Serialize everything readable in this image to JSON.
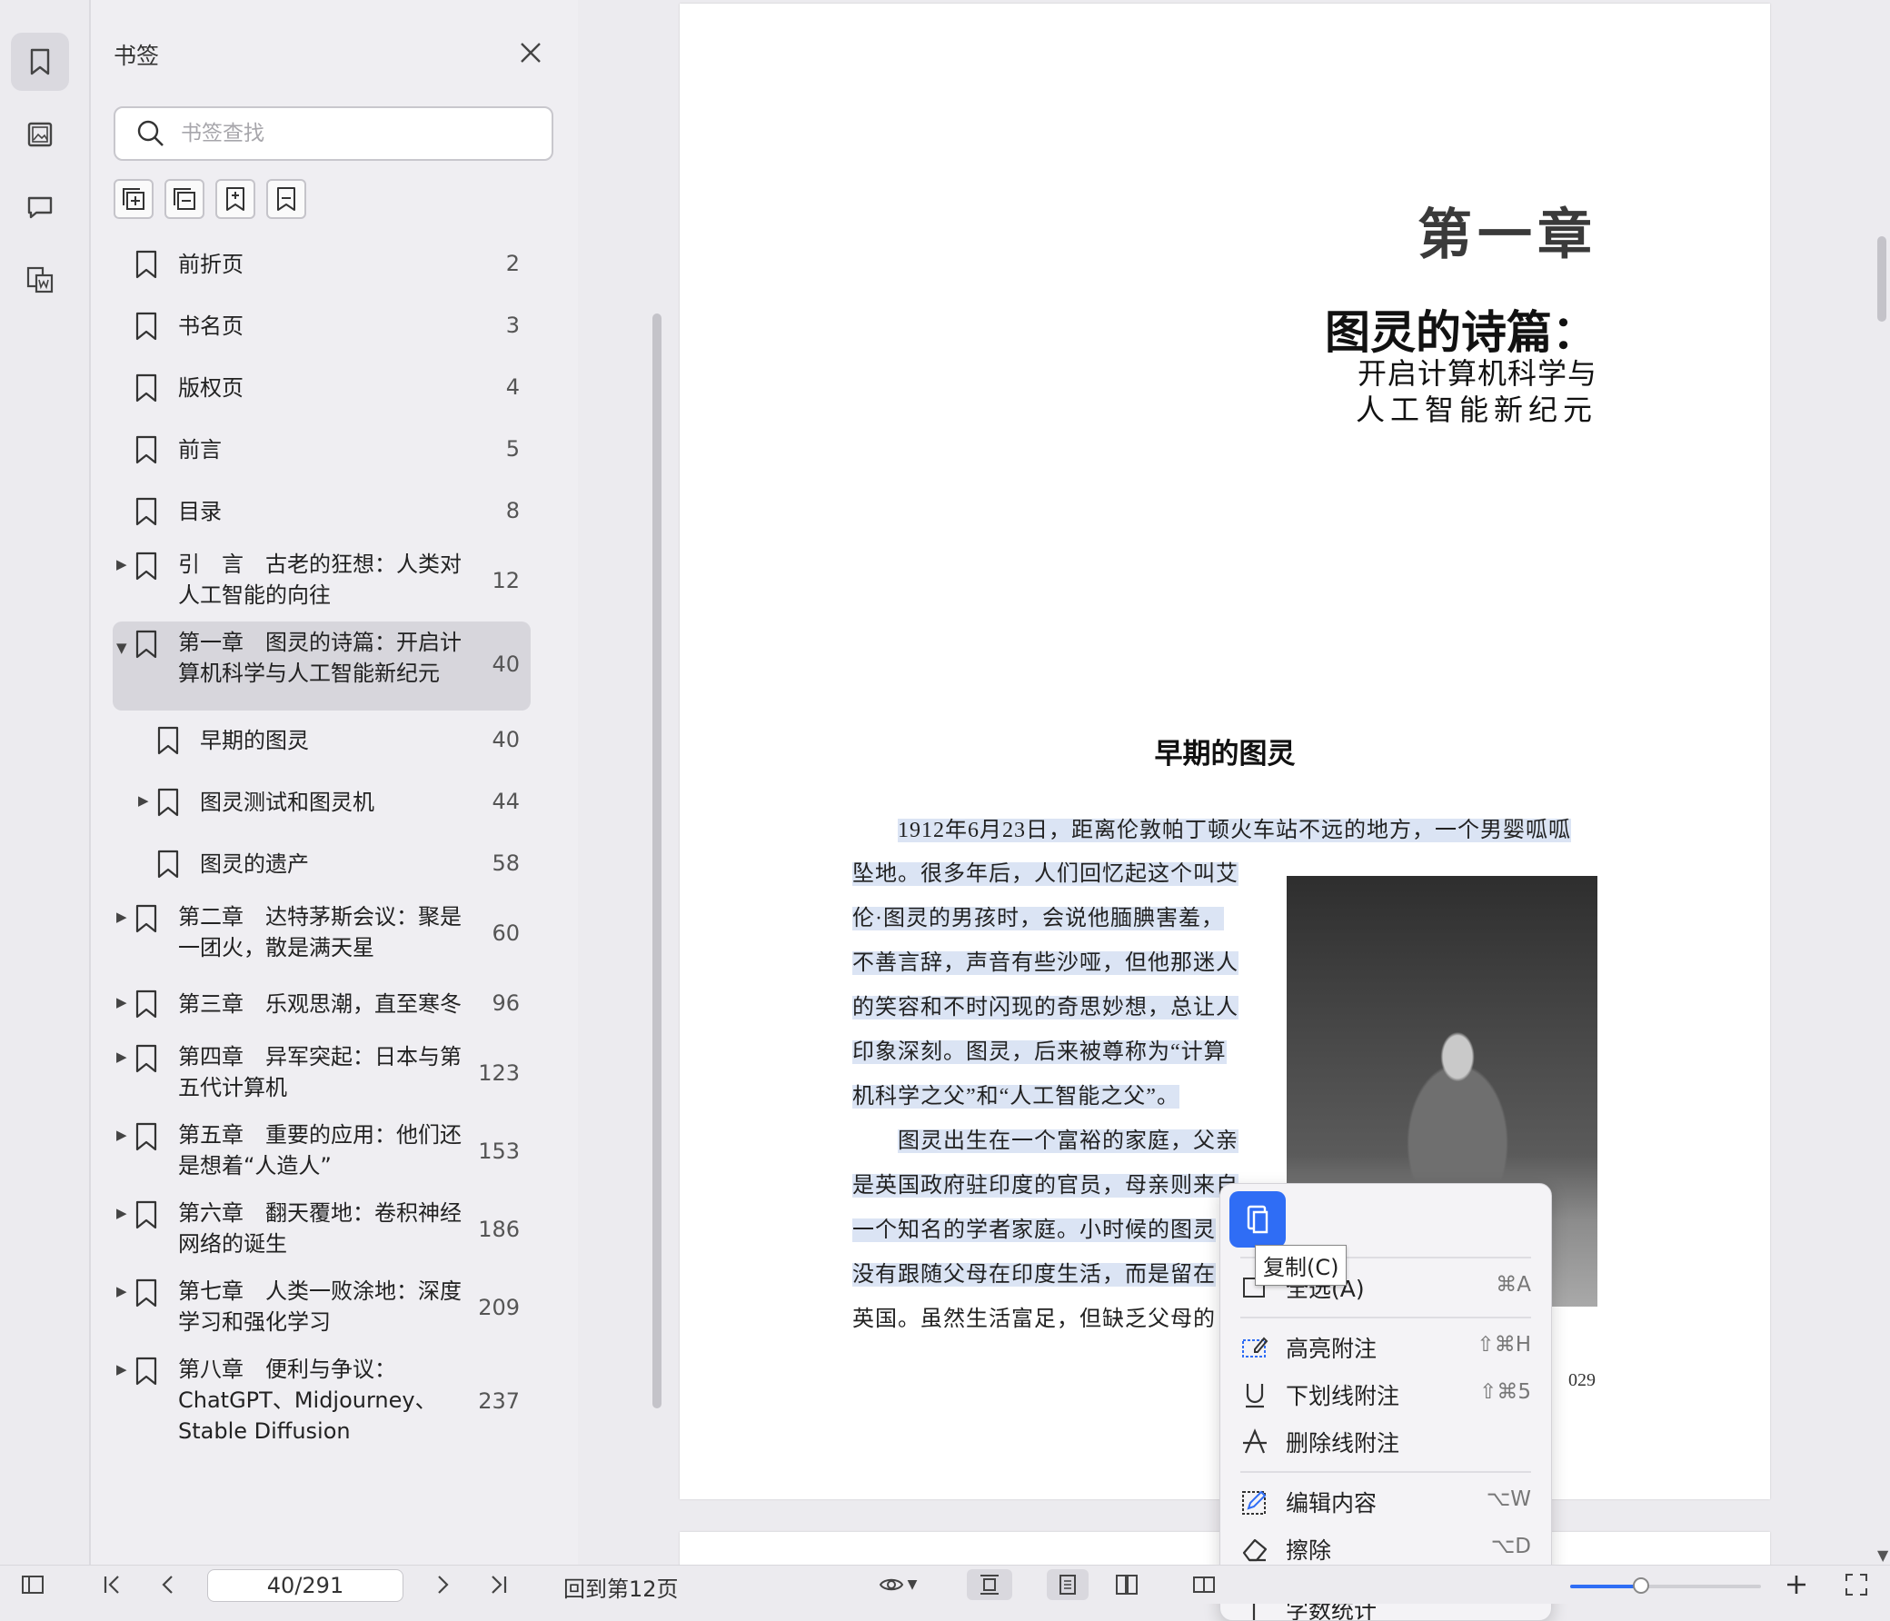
{
  "rail": {
    "items": [
      "bookmark-icon",
      "image-icon",
      "comment-icon",
      "extract-icon"
    ]
  },
  "panel": {
    "title": "书签",
    "search_placeholder": "书签查找",
    "tools": [
      "expand-all-icon",
      "collapse-all-icon",
      "add-bookmark-icon",
      "bookmark-flag-icon"
    ],
    "bookmarks": [
      {
        "label": "前折页",
        "page": "2",
        "level": 0,
        "arrow": ""
      },
      {
        "label": "书名页",
        "page": "3",
        "level": 0,
        "arrow": ""
      },
      {
        "label": "版权页",
        "page": "4",
        "level": 0,
        "arrow": ""
      },
      {
        "label": "前言",
        "page": "5",
        "level": 0,
        "arrow": ""
      },
      {
        "label": "目录",
        "page": "8",
        "level": 0,
        "arrow": ""
      },
      {
        "label": "引　言　古老的狂想：人类对人工智能的向往",
        "page": "12",
        "level": 0,
        "arrow": "collapsed"
      },
      {
        "label": "第一章　图灵的诗篇：开启计算机科学与人工智能新纪元",
        "page": "40",
        "level": 0,
        "arrow": "expanded",
        "active": true
      },
      {
        "label": "早期的图灵",
        "page": "40",
        "level": 1,
        "arrow": ""
      },
      {
        "label": "图灵测试和图灵机",
        "page": "44",
        "level": 1,
        "arrow": "collapsed"
      },
      {
        "label": "图灵的遗产",
        "page": "58",
        "level": 1,
        "arrow": ""
      },
      {
        "label": "第二章　达特茅斯会议：聚是一团火，散是满天星",
        "page": "60",
        "level": 0,
        "arrow": "collapsed"
      },
      {
        "label": "第三章　乐观思潮，直至寒冬",
        "page": "96",
        "level": 0,
        "arrow": "collapsed"
      },
      {
        "label": "第四章　异军突起：日本与第五代计算机",
        "page": "123",
        "level": 0,
        "arrow": "collapsed"
      },
      {
        "label": "第五章　重要的应用：他们还是想着“人造人”",
        "page": "153",
        "level": 0,
        "arrow": "collapsed"
      },
      {
        "label": "第六章　翻天覆地：卷积神经网络的诞生",
        "page": "186",
        "level": 0,
        "arrow": "collapsed"
      },
      {
        "label": "第七章　人类一败涂地：深度学习和强化学习",
        "page": "209",
        "level": 0,
        "arrow": "collapsed"
      },
      {
        "label": "第八章　便利与争议：ChatGPT、Midjourney、Stable Diffusion",
        "page": "237",
        "level": 0,
        "arrow": "collapsed"
      }
    ]
  },
  "document": {
    "chapter": "第一章",
    "title": "图灵的诗篇：",
    "subtitle_1": "开启计算机科学与",
    "subtitle_2": "人工智能新纪元",
    "section": "早期的图灵",
    "lines": [
      "1912年6月23日，距离伦敦帕丁顿火车站不远的地方，一个男婴呱呱",
      "坠地。很多年后，人们回忆起这个叫艾",
      "伦·图灵的男孩时，会说他腼腆害羞，",
      "不善言辞，声音有些沙哑，但他那迷人",
      "的笑容和不时闪现的奇思妙想，总让人",
      "印象深刻。图灵，后来被尊称为“计算",
      "机科学之父”和“人工智能之父”。",
      "图灵出生在一个富裕的家庭，父亲",
      "是英国政府驻印度的官员，母亲则来自",
      "一个知名的学者家庭。小时候的图灵",
      "没有跟随父母在印度生活，而是留在",
      "英国。虽然生活富足，但缺乏父母的"
    ],
    "page_number": "029"
  },
  "context_menu": {
    "copy_tooltip": "复制(C)",
    "items": [
      {
        "label": "全选(A)",
        "shortcut": "⌘A",
        "icon": "select-all-icon"
      },
      {
        "label": "高亮附注",
        "shortcut": "⇧⌘H",
        "icon": "highlight-icon"
      },
      {
        "label": "下划线附注",
        "shortcut": "⇧⌘5",
        "icon": "underline-icon"
      },
      {
        "label": "删除线附注",
        "shortcut": "",
        "icon": "strikethrough-icon"
      },
      {
        "label": "编辑内容",
        "shortcut": "⌥W",
        "icon": "edit-icon"
      },
      {
        "label": "擦除",
        "shortcut": "⌥D",
        "icon": "eraser-icon"
      },
      {
        "label": "字数统计",
        "shortcut": "",
        "icon": "text-icon"
      }
    ]
  },
  "toolbar": {
    "page_value": "40/291",
    "goto_label": "回到第12页",
    "zoom_fraction": 0.37
  }
}
